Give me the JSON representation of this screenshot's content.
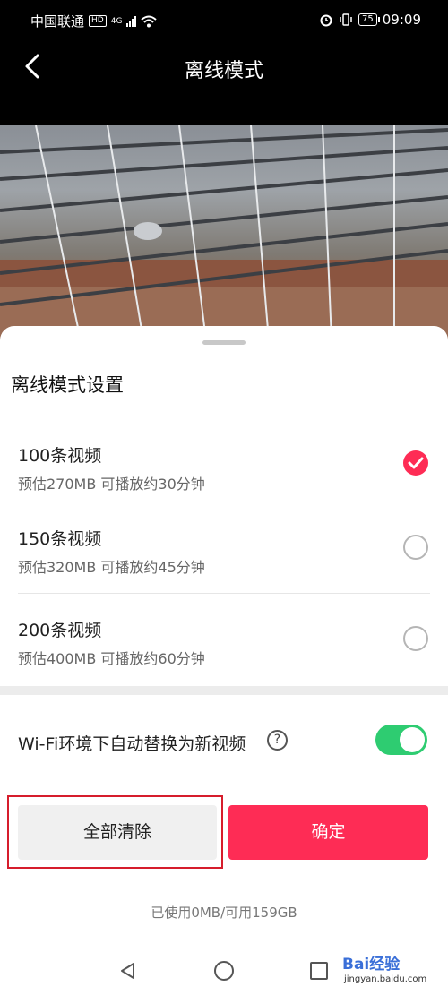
{
  "status_bar": {
    "carrier": "中国联通",
    "hd": "HD",
    "network": "4G",
    "battery": "75",
    "time": "09:09"
  },
  "header": {
    "title": "离线模式"
  },
  "sheet": {
    "title": "离线模式设置",
    "options": [
      {
        "title": "100条视频",
        "subtitle": "预估270MB 可播放约30分钟",
        "selected": true
      },
      {
        "title": "150条视频",
        "subtitle": "预估320MB 可播放约45分钟",
        "selected": false
      },
      {
        "title": "200条视频",
        "subtitle": "预估400MB 可播放约60分钟",
        "selected": false
      }
    ],
    "wifi_label": "Wi-Fi环境下自动替换为新视频",
    "wifi_toggle_on": true,
    "help_icon": "?",
    "clear_button": "全部清除",
    "confirm_button": "确定",
    "storage": "已使用0MB/可用159GB"
  },
  "watermark": {
    "brand": "Bai经验",
    "url": "jingyan.baidu.com"
  },
  "colors": {
    "accent": "#fe2c55",
    "toggle_on": "#2ecc71",
    "highlight_box": "#d61d2c"
  }
}
